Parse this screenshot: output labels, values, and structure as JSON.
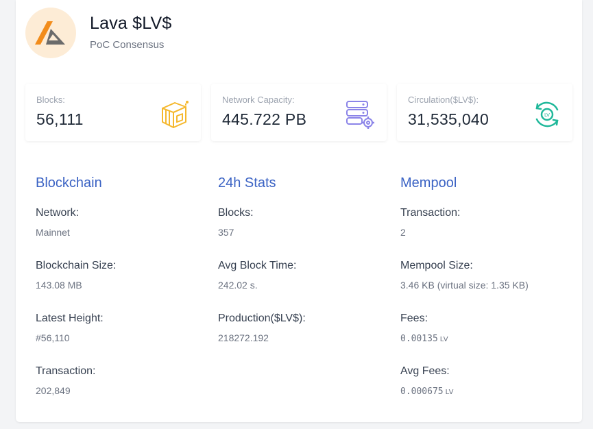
{
  "header": {
    "title": "Lava $LV$",
    "subtitle": "PoC Consensus",
    "logo_icon": "lava-logo-icon"
  },
  "stats": [
    {
      "label": "Blocks:",
      "value": "56,111",
      "icon": "blocks-cube-icon",
      "color": "#f5b82e"
    },
    {
      "label": "Network Capacity:",
      "value": "445.722 PB",
      "icon": "server-gear-icon",
      "color": "#8b84e8"
    },
    {
      "label": "Circulation($LV$):",
      "value": "31,535,040",
      "icon": "circulation-coin-icon",
      "color": "#1fb89a"
    }
  ],
  "blockchain": {
    "title": "Blockchain",
    "fields": [
      {
        "label": "Network:",
        "value": "Mainnet"
      },
      {
        "label": "Blockchain Size:",
        "value": "143.08 MB"
      },
      {
        "label": "Latest Height:",
        "value": "#56,110"
      },
      {
        "label": "Transaction:",
        "value": "202,849"
      }
    ]
  },
  "stats24h": {
    "title": "24h Stats",
    "fields": [
      {
        "label": "Blocks:",
        "value": "357"
      },
      {
        "label": "Avg Block Time:",
        "value": "242.02 s."
      },
      {
        "label": "Production($LV$):",
        "value": "218272.192"
      }
    ]
  },
  "mempool": {
    "title": "Mempool",
    "fields": [
      {
        "label": "Transaction:",
        "value": "2"
      },
      {
        "label": "Mempool Size:",
        "value": "3.46 KB (virtual size: 1.35 KB)"
      },
      {
        "label": "Fees:",
        "value": "0.00135",
        "unit": "LV"
      },
      {
        "label": "Avg Fees:",
        "value": "0.000675",
        "unit": "LV"
      }
    ]
  },
  "colors": {
    "accent": "#3b63c4",
    "logo_orange": "#f28c1b",
    "logo_gray": "#6b6b6b",
    "logo_bg": "#fdecd6"
  }
}
